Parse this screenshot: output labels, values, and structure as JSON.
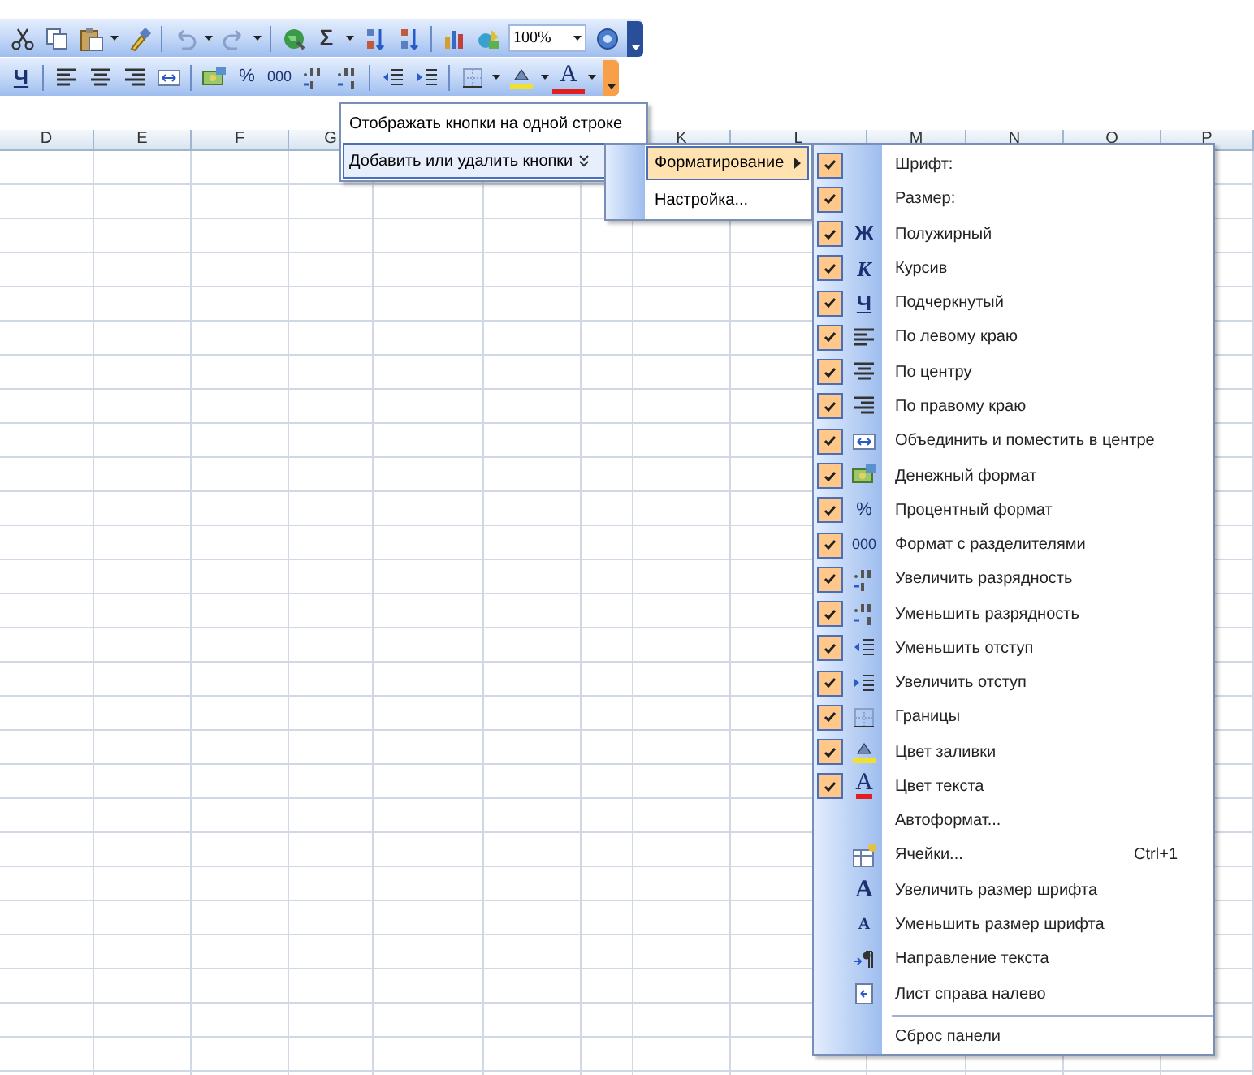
{
  "toolbars": [
    {
      "items": [
        {
          "kind": "cut"
        },
        {
          "kind": "copy"
        },
        {
          "kind": "paste"
        },
        {
          "kind": "arrow"
        },
        {
          "kind": "brush"
        },
        {
          "kind": "separator"
        },
        {
          "kind": "undo"
        },
        {
          "kind": "arrow"
        },
        {
          "kind": "redo"
        },
        {
          "kind": "arrow"
        },
        {
          "kind": "separator"
        },
        {
          "kind": "globe"
        },
        {
          "kind": "sum",
          "glyph": "Σ"
        },
        {
          "kind": "arrow"
        },
        {
          "kind": "sort-asc"
        },
        {
          "kind": "sort-desc"
        },
        {
          "kind": "separator"
        },
        {
          "kind": "chart"
        },
        {
          "kind": "drawing"
        },
        {
          "kind": "field",
          "value": "100%"
        },
        {
          "kind": "help"
        },
        {
          "kind": "grip",
          "selected": false
        }
      ]
    },
    {
      "items": [
        {
          "kind": "underline",
          "glyph": "Ч"
        },
        {
          "kind": "separator"
        },
        {
          "kind": "align-left"
        },
        {
          "kind": "align-center"
        },
        {
          "kind": "align-right"
        },
        {
          "kind": "merge"
        },
        {
          "kind": "separator"
        },
        {
          "kind": "currency"
        },
        {
          "kind": "percent",
          "glyph": "%"
        },
        {
          "kind": "thousands",
          "glyph": "000"
        },
        {
          "kind": "inc-decimal"
        },
        {
          "kind": "dec-decimal"
        },
        {
          "kind": "separator"
        },
        {
          "kind": "outdent"
        },
        {
          "kind": "indent"
        },
        {
          "kind": "separator"
        },
        {
          "kind": "borders"
        },
        {
          "kind": "arrow"
        },
        {
          "kind": "fill"
        },
        {
          "kind": "arrow"
        },
        {
          "kind": "font-color",
          "glyph": "A"
        },
        {
          "kind": "arrow"
        },
        {
          "kind": "grip",
          "selected": true
        }
      ]
    }
  ],
  "columns": [
    "D",
    "E",
    "F",
    "G",
    "K",
    "L",
    "M",
    "N",
    "O",
    "P"
  ],
  "options_menu": {
    "items": [
      {
        "label": "Отображать кнопки на одной строке",
        "selected": false,
        "submenu": false
      },
      {
        "label": "Добавить или удалить кнопки",
        "selected": true,
        "submenu": true
      }
    ]
  },
  "toolbar_submenu": {
    "items": [
      {
        "label": "Форматирование",
        "selected": true,
        "submenu": true
      },
      {
        "label": "Настройка...",
        "selected": false,
        "submenu": false
      }
    ]
  },
  "buttons_menu": {
    "items": [
      {
        "kind": "plain",
        "label": "Шрифт:",
        "checked": true
      },
      {
        "kind": "plain",
        "label": "Размер:",
        "checked": true
      },
      {
        "kind": "bold",
        "label": "Полужирный",
        "checked": true,
        "glyph": "Ж"
      },
      {
        "kind": "italic",
        "label": "Курсив",
        "checked": true,
        "glyph": "К"
      },
      {
        "kind": "underline",
        "label": "Подчеркнутый",
        "checked": true,
        "glyph": "Ч"
      },
      {
        "kind": "align-left",
        "label": "По левому краю",
        "checked": true
      },
      {
        "kind": "align-center",
        "label": "По центру",
        "checked": true
      },
      {
        "kind": "align-right",
        "label": "По правому краю",
        "checked": true
      },
      {
        "kind": "merge",
        "label": "Объединить и поместить в центре",
        "checked": true
      },
      {
        "kind": "currency",
        "label": "Денежный формат",
        "checked": true
      },
      {
        "kind": "percent",
        "label": "Процентный формат",
        "checked": true,
        "glyph": "%"
      },
      {
        "kind": "thousands",
        "label": "Формат с разделителями",
        "checked": true,
        "glyph": "000"
      },
      {
        "kind": "inc-decimal",
        "label": "Увеличить разрядность",
        "checked": true
      },
      {
        "kind": "dec-decimal",
        "label": "Уменьшить разрядность",
        "checked": true
      },
      {
        "kind": "outdent",
        "label": "Уменьшить отступ",
        "checked": true
      },
      {
        "kind": "indent",
        "label": "Увеличить отступ",
        "checked": true
      },
      {
        "kind": "borders",
        "label": "Границы",
        "checked": true
      },
      {
        "kind": "fill",
        "label": "Цвет заливки",
        "checked": true
      },
      {
        "kind": "font-color",
        "label": "Цвет текста",
        "checked": true,
        "glyph": "A"
      },
      {
        "kind": "plain",
        "label": "Автоформат...",
        "checked": false
      },
      {
        "kind": "cells",
        "label": "Ячейки...",
        "checked": false,
        "shortcut": "Ctrl+1"
      },
      {
        "kind": "grow-font",
        "label": "Увеличить размер шрифта",
        "checked": false,
        "glyph": "A"
      },
      {
        "kind": "shrink-font",
        "label": "Уменьшить размер шрифта",
        "checked": false,
        "glyph": "A"
      },
      {
        "kind": "direction",
        "label": "Направление текста",
        "checked": false
      },
      {
        "kind": "rtl",
        "label": "Лист справа налево",
        "checked": false
      },
      {
        "kind": "separator"
      },
      {
        "kind": "plain",
        "label": "Сброс панели",
        "checked": false
      }
    ]
  }
}
